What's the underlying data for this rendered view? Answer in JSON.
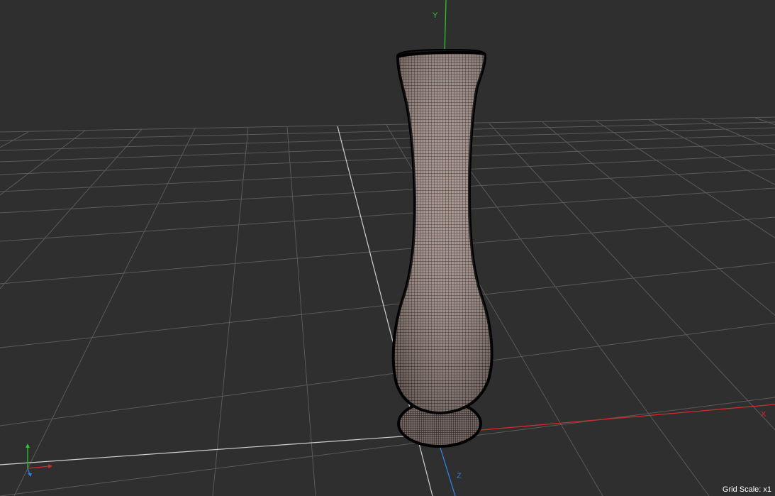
{
  "viewport": {
    "background": "#2f2f2f",
    "grid_scale_label": "Grid Scale: x1",
    "axes": {
      "x": {
        "label": "X",
        "color": "#d42a2a"
      },
      "y": {
        "label": "Y",
        "color": "#2ec22e"
      },
      "z": {
        "label": "Z",
        "color": "#2f7fe0"
      }
    },
    "model": {
      "name": "vase",
      "display_mode": "wireframe-on-shaded",
      "fill_color": "#a58e86",
      "wire_color": "#1a1a1a"
    },
    "gizmo_icon": "orientation-axes-icon"
  }
}
